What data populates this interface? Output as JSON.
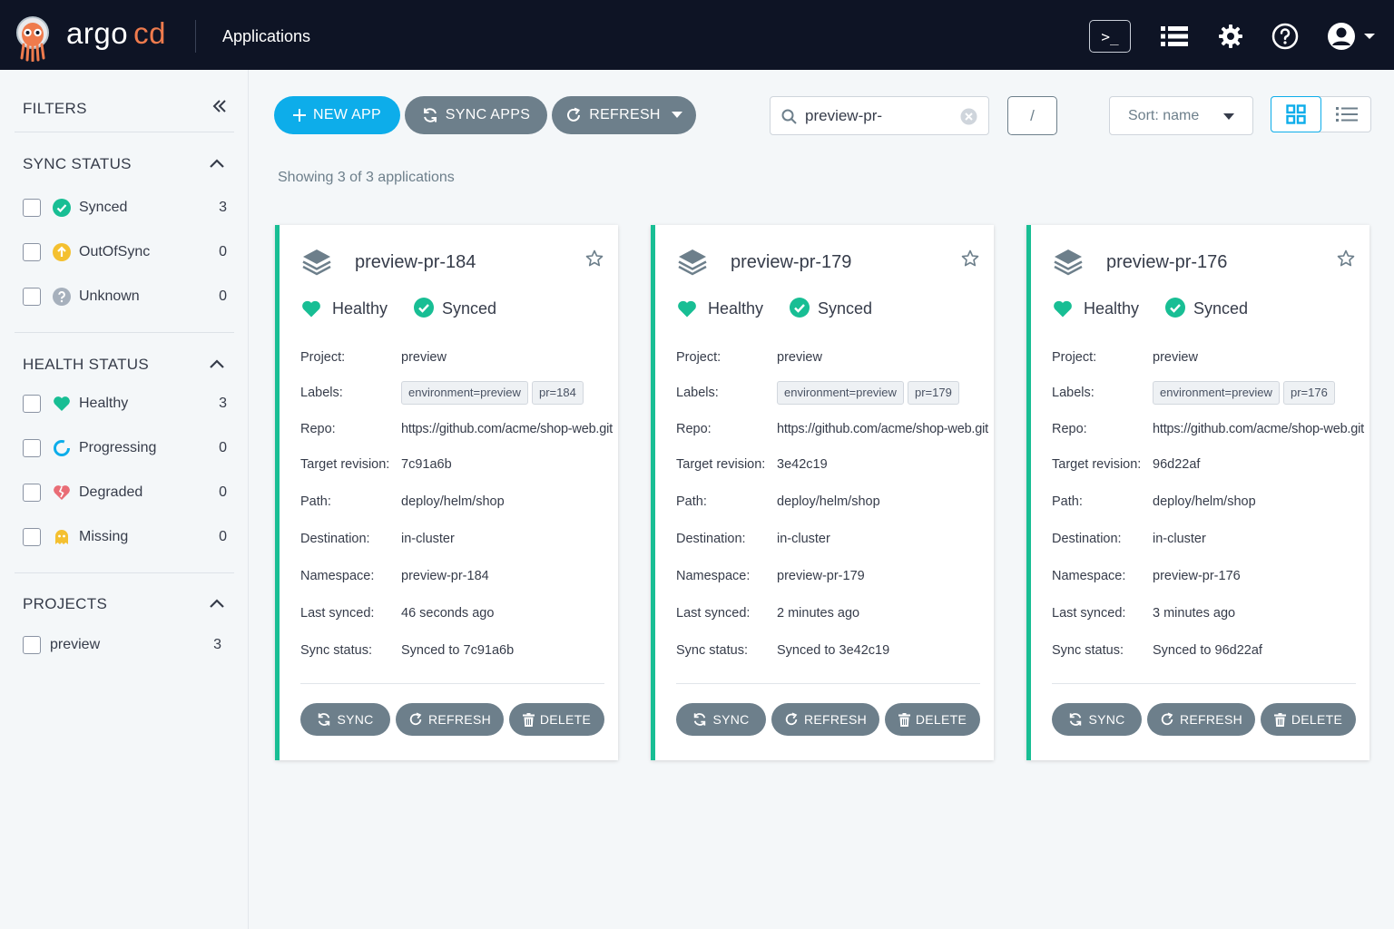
{
  "header": {
    "brand_main": "argo",
    "brand_accent": "cd",
    "page_title": "Applications",
    "terminal_glyph": ">_"
  },
  "sidebar": {
    "title": "FILTERS",
    "sync_status": {
      "title": "SYNC STATUS",
      "items": [
        {
          "label": "Synced",
          "count": "3",
          "icon": "check-circle-icon",
          "color": "#18be94"
        },
        {
          "label": "OutOfSync",
          "count": "0",
          "icon": "arrow-up-circle-icon",
          "color": "#f4c030"
        },
        {
          "label": "Unknown",
          "count": "0",
          "icon": "question-circle-icon",
          "color": "#a6b0bc"
        }
      ]
    },
    "health_status": {
      "title": "HEALTH STATUS",
      "items": [
        {
          "label": "Healthy",
          "count": "3",
          "icon": "heart-icon",
          "color": "#18be94"
        },
        {
          "label": "Progressing",
          "count": "0",
          "icon": "progress-ring-icon",
          "color": "#0dadea"
        },
        {
          "label": "Degraded",
          "count": "0",
          "icon": "broken-heart-icon",
          "color": "#e96d76"
        },
        {
          "label": "Missing",
          "count": "0",
          "icon": "ghost-icon",
          "color": "#f4c030"
        }
      ]
    },
    "projects": {
      "title": "PROJECTS",
      "items": [
        {
          "label": "preview",
          "count": "3"
        }
      ]
    }
  },
  "toolbar": {
    "new_app": "NEW APP",
    "sync_apps": "SYNC APPS",
    "refresh": "REFRESH",
    "search_value": "preview-pr-",
    "slash": "/",
    "sort": "Sort: name"
  },
  "summary": "Showing 3 of 3 applications",
  "labels": {
    "project": "Project:",
    "labels": "Labels:",
    "repo": "Repo:",
    "target_revision": "Target revision:",
    "path": "Path:",
    "destination": "Destination:",
    "namespace": "Namespace:",
    "last_synced": "Last synced:",
    "sync_status": "Sync status:"
  },
  "card_buttons": {
    "sync": "SYNC",
    "refresh": "REFRESH",
    "delete": "DELETE"
  },
  "apps": [
    {
      "name": "preview-pr-184",
      "health": "Healthy",
      "sync": "Synced",
      "project": "preview",
      "label_tags": [
        "environment=preview",
        "pr=184"
      ],
      "repo": "https://github.com/acme/shop-web.git",
      "target_revision": "7c91a6b",
      "path": "deploy/helm/shop",
      "destination": "in-cluster",
      "namespace": "preview-pr-184",
      "last_synced": "46 seconds ago",
      "sync_status": "Synced to 7c91a6b"
    },
    {
      "name": "preview-pr-179",
      "health": "Healthy",
      "sync": "Synced",
      "project": "preview",
      "label_tags": [
        "environment=preview",
        "pr=179"
      ],
      "repo": "https://github.com/acme/shop-web.git",
      "target_revision": "3e42c19",
      "path": "deploy/helm/shop",
      "destination": "in-cluster",
      "namespace": "preview-pr-179",
      "last_synced": "2 minutes ago",
      "sync_status": "Synced to 3e42c19"
    },
    {
      "name": "preview-pr-176",
      "health": "Healthy",
      "sync": "Synced",
      "project": "preview",
      "label_tags": [
        "environment=preview",
        "pr=176"
      ],
      "repo": "https://github.com/acme/shop-web.git",
      "target_revision": "96d22af",
      "path": "deploy/helm/shop",
      "destination": "in-cluster",
      "namespace": "preview-pr-176",
      "last_synced": "3 minutes ago",
      "sync_status": "Synced to 96d22af"
    }
  ],
  "colors": {
    "topbar": "#0e1425",
    "accent_orange": "#ef7b4d",
    "primary": "#0dadea",
    "secondary": "#6d7f8b",
    "healthy": "#18be94"
  }
}
